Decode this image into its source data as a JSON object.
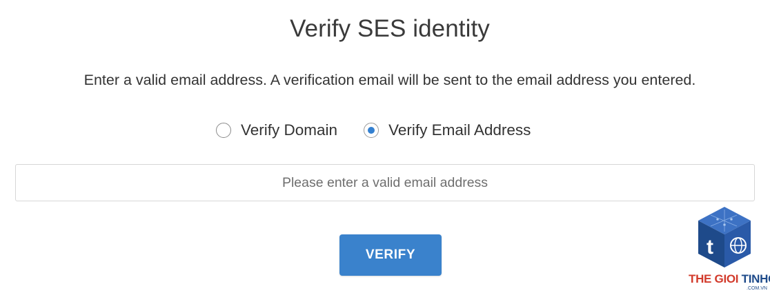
{
  "page": {
    "title": "Verify SES identity",
    "description": "Enter a valid email address. A verification email will be sent to the email address you entered."
  },
  "identity_type": {
    "options": [
      {
        "label": "Verify Domain",
        "selected": false
      },
      {
        "label": "Verify Email Address",
        "selected": true
      }
    ]
  },
  "email_field": {
    "value": "",
    "placeholder": "Please enter a valid email address"
  },
  "actions": {
    "verify_label": "VERIFY"
  },
  "watermark": {
    "brand_part1": "THE GIOI ",
    "brand_part2": "TINHOC",
    "brand_sub": ".COM.VN",
    "icon": "cube-logo-icon"
  },
  "colors": {
    "accent": "#3a82cc",
    "radio_selected": "#3480d0",
    "logo_blue": "#1e4a8a",
    "logo_red": "#d23a2b"
  }
}
